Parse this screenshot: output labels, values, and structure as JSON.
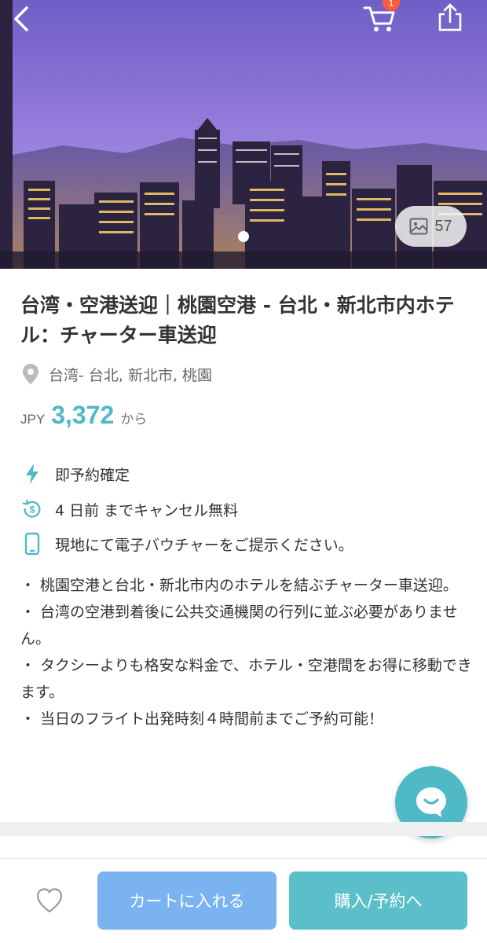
{
  "header": {
    "back_icon": "chevron-left-icon",
    "cart_icon": "cart-icon",
    "cart_badge": "1",
    "share_icon": "share-icon"
  },
  "gallery": {
    "photo_count": "57",
    "image_icon": "image-icon"
  },
  "product": {
    "title": "台湾・空港送迎｜桃園空港 - 台北・新北市内ホテル：チャーター車送迎",
    "location": "台湾- 台北, 新北市, 桃園",
    "currency": "JPY",
    "price": "3,372",
    "price_suffix": "から"
  },
  "features": [
    {
      "icon": "lightning-icon",
      "text": "即予約確定"
    },
    {
      "icon": "refund-icon",
      "text": "4 日前 までキャンセル無料"
    },
    {
      "icon": "phone-icon",
      "text": "現地にて電子バウチャーをご提示ください。"
    }
  ],
  "highlights": [
    "・ 桃園空港と台北・新北市内のホテルを結ぶチャーター車送迎。",
    "・ 台湾の空港到着後に公共交通機関の行列に並ぶ必要がありません。",
    "・ タクシーよりも格安な料金で、ホテル・空港間をお得に移動できます。",
    "・ 当日のフライト出発時刻４時間前までご予約可能！"
  ],
  "footer": {
    "add_to_cart": "カートに入れる",
    "book": "購入/予約へ"
  },
  "colors": {
    "accent": "#4fb9c6",
    "cart_button": "#7bb3f0",
    "book_button": "#5bbfc9",
    "badge": "#ff5b3a"
  }
}
